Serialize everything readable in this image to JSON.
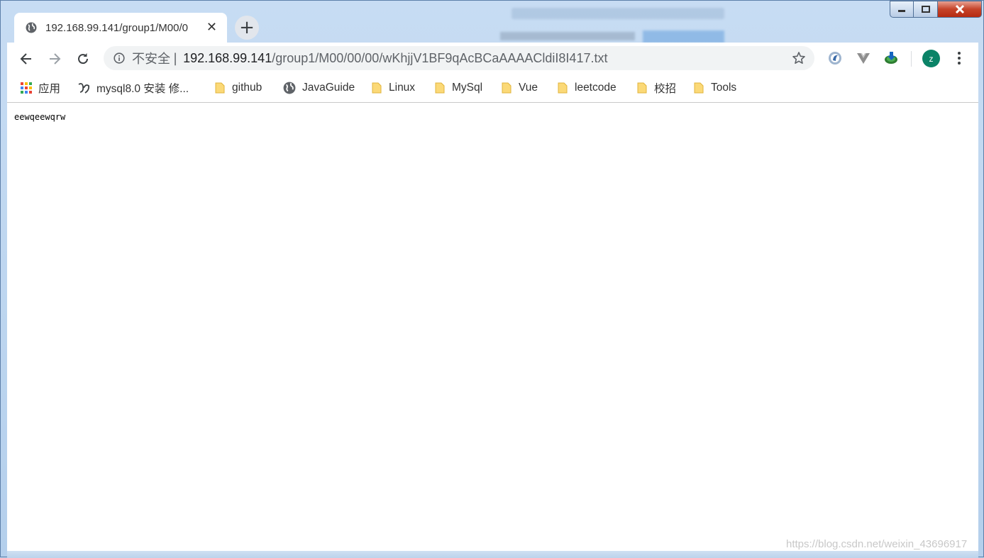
{
  "tab": {
    "title": "192.168.99.141/group1/M00/0",
    "close": "✕",
    "new_tab": "+"
  },
  "omnibox": {
    "security_label": "不安全",
    "separator": "|",
    "host": "192.168.99.141",
    "path": "/group1/M00/00/00/wKhjjV1BF9qAcBCaAAAACldiI8I417.txt"
  },
  "profile": {
    "initial": "z",
    "color": "#0b8367"
  },
  "bookmarks": [
    {
      "label": "应用",
      "icon": "apps-grid-icon"
    },
    {
      "label": "mysql8.0 安装 修...",
      "icon": "site-favicon-icon"
    },
    {
      "label": "github",
      "icon": "folder-icon"
    },
    {
      "label": "JavaGuide",
      "icon": "globe-icon"
    },
    {
      "label": "Linux",
      "icon": "folder-icon"
    },
    {
      "label": "MySql",
      "icon": "folder-icon"
    },
    {
      "label": "Vue",
      "icon": "folder-icon"
    },
    {
      "label": "leetcode",
      "icon": "folder-icon"
    },
    {
      "label": "校招",
      "icon": "folder-icon"
    },
    {
      "label": "Tools",
      "icon": "folder-icon"
    }
  ],
  "page": {
    "text": "eewqeewqrw"
  },
  "watermark": "https://blog.csdn.net/weixin_43696917"
}
